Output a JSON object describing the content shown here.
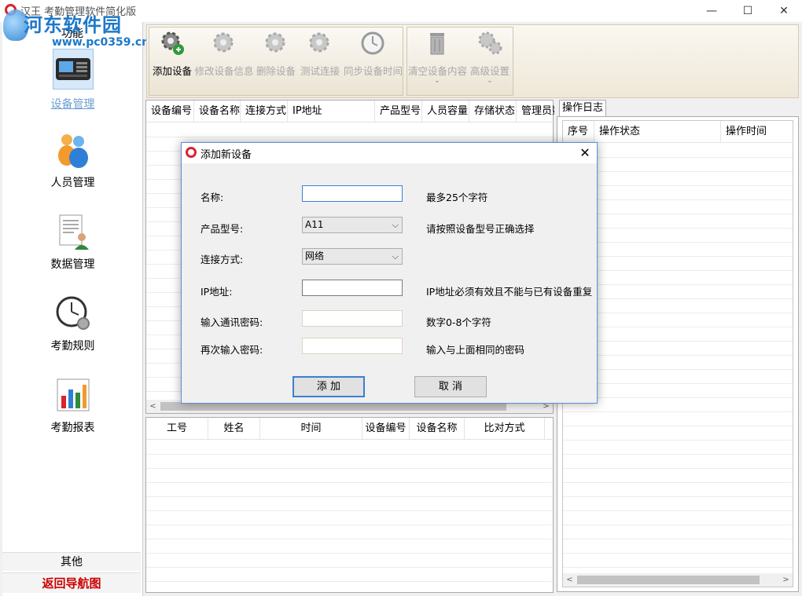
{
  "window": {
    "title": "汉王 考勤管理软件简化版",
    "watermark_text": "河东软件园",
    "watermark_url": "www.pc0359.cn",
    "controls": {
      "minimize": "—",
      "maximize": "☐",
      "close": "✕"
    }
  },
  "sidebar": {
    "header": "功能",
    "items": [
      {
        "label": "设备管理",
        "selected": true
      },
      {
        "label": "人员管理"
      },
      {
        "label": "数据管理"
      },
      {
        "label": "考勤规则"
      },
      {
        "label": "考勤报表"
      }
    ],
    "other": "其他",
    "back": "返回导航图"
  },
  "toolbar": {
    "buttons": [
      {
        "label": "添加设备",
        "enabled": true
      },
      {
        "label": "修改设备信息",
        "enabled": false
      },
      {
        "label": "删除设备",
        "enabled": false
      },
      {
        "label": "测试连接",
        "enabled": false
      },
      {
        "label": "同步设备时间",
        "enabled": false
      },
      {
        "label": "清空设备内容",
        "enabled": false,
        "dropdown": true
      },
      {
        "label": "高级设置",
        "enabled": false,
        "dropdown": true
      }
    ]
  },
  "device_table": {
    "columns": [
      "设备编号",
      "设备名称",
      "连接方式",
      "IP地址",
      "产品型号",
      "人员容量",
      "存储状态",
      "管理员数"
    ]
  },
  "record_table": {
    "columns": [
      "工号",
      "姓名",
      "时间",
      "设备编号",
      "设备名称",
      "比对方式"
    ]
  },
  "log_panel": {
    "tab": "操作日志",
    "columns": [
      "序号",
      "操作状态",
      "操作时间"
    ]
  },
  "dialog": {
    "title": "添加新设备",
    "close": "✕",
    "fields": [
      {
        "label": "名称:",
        "value": "",
        "hint": "最多25个字符"
      },
      {
        "label": "产品型号:",
        "value": "A11",
        "hint": "请按照设备型号正确选择"
      },
      {
        "label": "连接方式:",
        "value": "网络",
        "hint": ""
      },
      {
        "label": "IP地址:",
        "value": "",
        "hint": "IP地址必须有效且不能与已有设备重复"
      },
      {
        "label": "输入通讯密码:",
        "value": "",
        "hint": "数字0-8个字符"
      },
      {
        "label": "再次输入密码:",
        "value": "",
        "hint": "输入与上面相同的密码"
      }
    ],
    "add_button": "添 加",
    "cancel_button": "取 消"
  },
  "colors": {
    "accent_blue": "#3c7fd1",
    "brand_red": "#d9232d",
    "back_red": "#cc0000"
  }
}
